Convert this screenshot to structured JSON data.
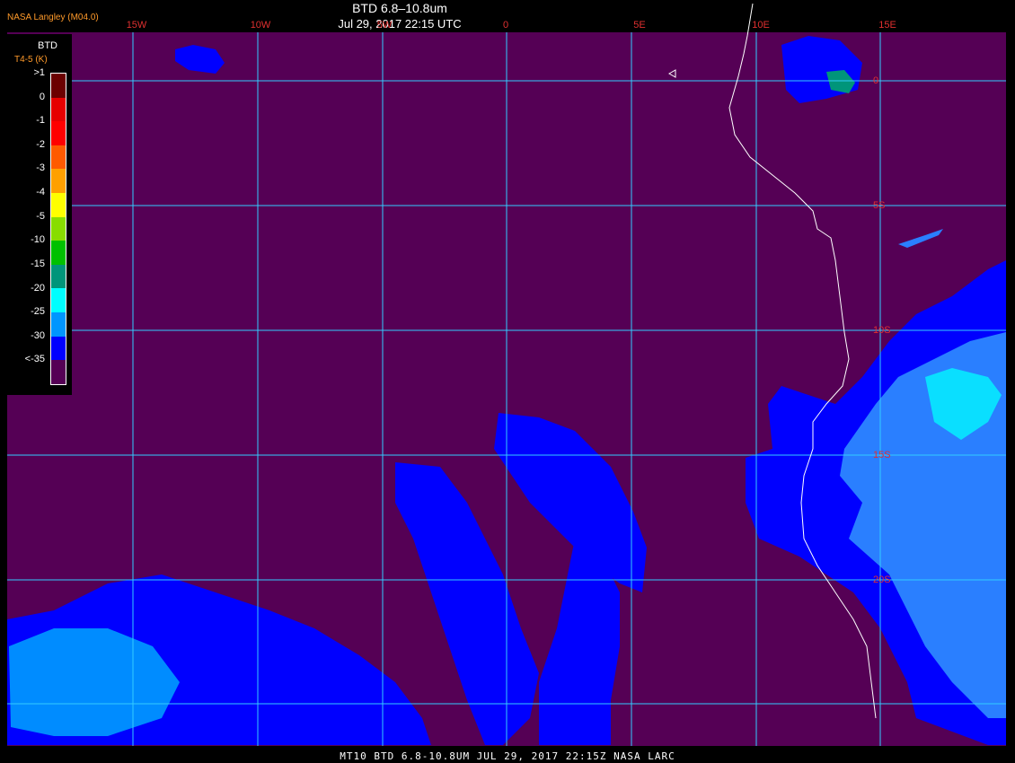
{
  "header": {
    "title": "BTD 6.8–10.8um",
    "subtitle": "Jul 29, 2017 22:15 UTC",
    "credit": "NASA Langley (M04.0)"
  },
  "grid": {
    "longitudes": [
      "15W",
      "10W",
      "5W",
      "0",
      "5E",
      "10E",
      "15E"
    ],
    "latitudes": [
      "0",
      "5S",
      "10S",
      "15S",
      "20S"
    ]
  },
  "legend": {
    "title": "BTD",
    "units": "T4-5 (K)",
    "items": [
      {
        "label": ">1",
        "color": "#6b0000"
      },
      {
        "label": "0",
        "color": "#e60000"
      },
      {
        "label": "-1",
        "color": "#ff0000"
      },
      {
        "label": "-2",
        "color": "#ff5a00"
      },
      {
        "label": "-3",
        "color": "#ffa000"
      },
      {
        "label": "-4",
        "color": "#ffff00"
      },
      {
        "label": "-5",
        "color": "#88dd00"
      },
      {
        "label": "-10",
        "color": "#00c000"
      },
      {
        "label": "-15",
        "color": "#00957a"
      },
      {
        "label": "-20",
        "color": "#00ffff"
      },
      {
        "label": "-25",
        "color": "#0096ff"
      },
      {
        "label": "-30",
        "color": "#0000ff"
      },
      {
        "label": "<-35",
        "color": "#550055"
      }
    ]
  },
  "colors": {
    "background": "#550055",
    "low_cloud": "#0000ff",
    "mid_cloud": "#2a7fff",
    "high_cloud": "#00ffff",
    "grid": "#33ccff",
    "coast": "#ffffff"
  },
  "footer": {
    "text": "MT10  BTD 6.8-10.8UM   JUL 29, 2017 22:15Z   NASA LARC"
  }
}
